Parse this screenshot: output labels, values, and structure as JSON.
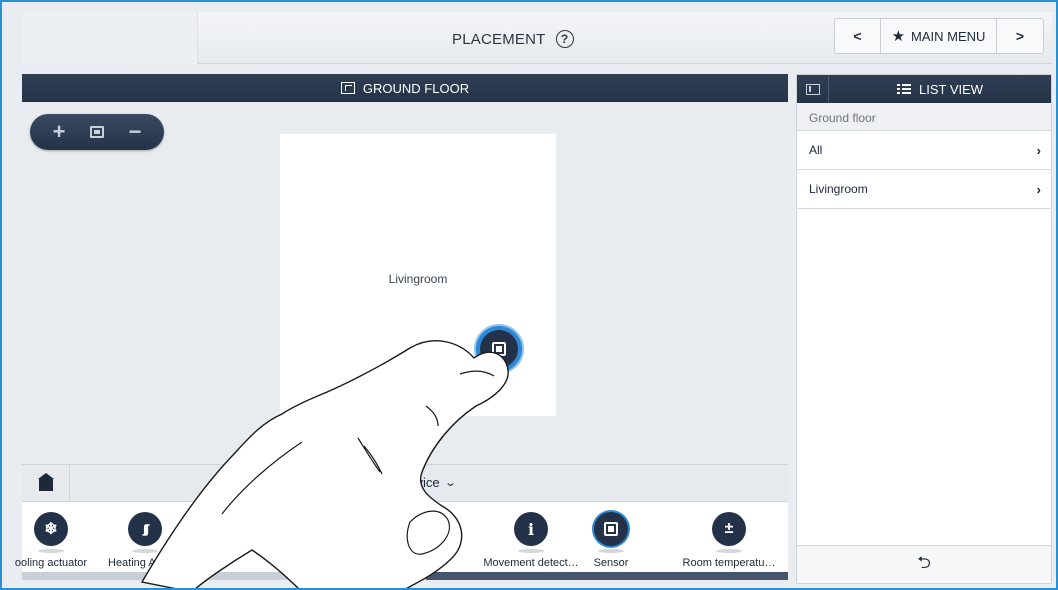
{
  "header": {
    "title": "PLACEMENT",
    "help_icon": "?",
    "prev_label": "<",
    "menu_label": "MAIN MENU",
    "next_label": ">"
  },
  "floor": {
    "title": "GROUND FLOOR",
    "zoom_in": "+",
    "zoom_out": "−",
    "room_label": "Livingroom"
  },
  "device_bar": {
    "select_label": "device"
  },
  "devices": [
    {
      "label": "ooling actuator",
      "icon": "snowflake-icon",
      "glyph": "❄"
    },
    {
      "label": "Heating Ac",
      "icon": "heating-icon",
      "glyph": "∫∫∫"
    },
    {
      "label": "Movement detect…",
      "icon": "movement-detector-icon",
      "glyph": "i"
    },
    {
      "label": "Sensor",
      "icon": "sensor-icon",
      "glyph": ""
    },
    {
      "label": "Room temperatu…",
      "icon": "thermometer-icon",
      "glyph": "±"
    }
  ],
  "list_view": {
    "title": "LIST VIEW",
    "section": "Ground floor",
    "items": [
      {
        "label": "All"
      },
      {
        "label": "Livingroom"
      }
    ]
  }
}
